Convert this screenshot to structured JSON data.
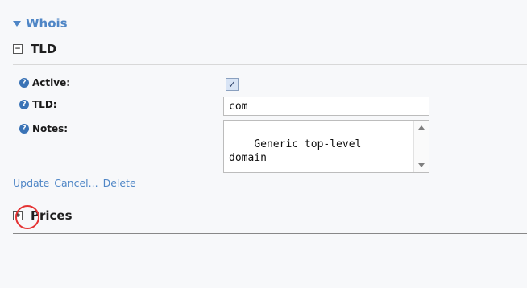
{
  "sections": {
    "whois": {
      "label": "Whois"
    },
    "tld": {
      "label": "TLD"
    },
    "prices": {
      "label": "Prices"
    }
  },
  "form": {
    "active": {
      "label": "Active:",
      "checked": true
    },
    "tld": {
      "label": "TLD:",
      "value": "com"
    },
    "notes": {
      "label": "Notes:",
      "value": "Generic top-level\ndomain"
    }
  },
  "actions": {
    "update": "Update",
    "cancel": "Cancel...",
    "delete": "Delete"
  },
  "icons": {
    "help": "question-circle-icon",
    "expand": "expand-plus-icon",
    "collapse": "collapse-minus-icon",
    "triangle": "triangle-down-icon"
  },
  "colors": {
    "accent": "#4f86c6",
    "annotation_circle": "#e53232"
  }
}
